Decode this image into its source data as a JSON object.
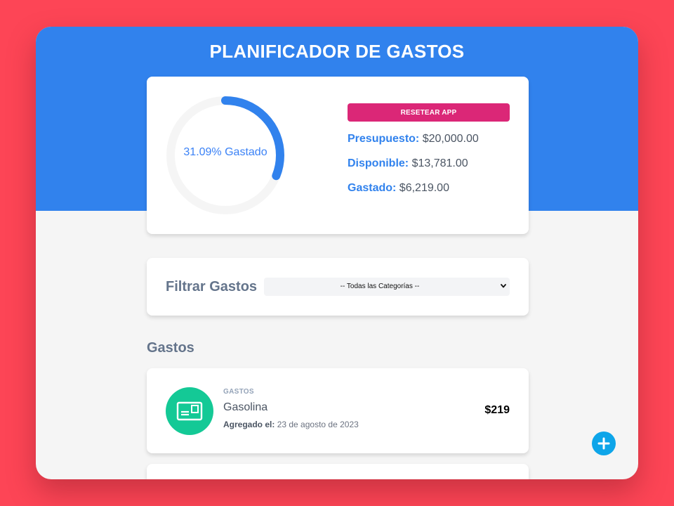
{
  "app": {
    "title": "PLANIFICADOR DE GASTOS"
  },
  "budget": {
    "progress_percent": 31.09,
    "progress_label": "31.09% Gastado",
    "reset_label": "RESETEAR APP",
    "presupuesto_label": "Presupuesto:",
    "presupuesto_value": "$20,000.00",
    "disponible_label": "Disponible:",
    "disponible_value": "$13,781.00",
    "gastado_label": "Gastado:",
    "gastado_value": "$6,219.00",
    "colors": {
      "accent": "#3182ed",
      "reset": "#db2777",
      "track": "#f5f5f5"
    }
  },
  "filter": {
    "label": "Filtrar Gastos",
    "selected": "-- Todas las Categorías --"
  },
  "expenses_section": {
    "title": "Gastos",
    "items": [
      {
        "category": "GASTOS",
        "name": "Gasolina",
        "date_label": "Agregado el:",
        "date_value": "23 de agosto de 2023",
        "amount": "$219",
        "icon": "card-icon",
        "icon_bg": "#14c996"
      }
    ]
  },
  "fab": {
    "icon": "plus-icon",
    "color": "#0ea5e9"
  }
}
